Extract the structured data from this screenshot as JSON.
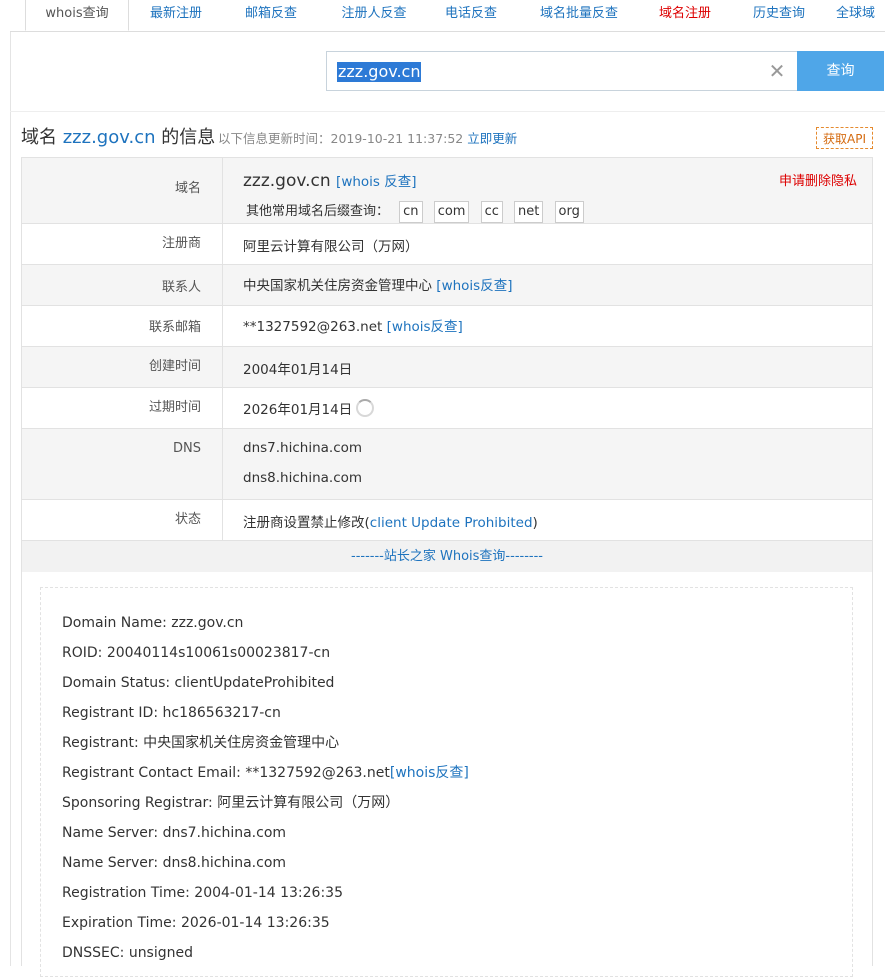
{
  "tabs": [
    {
      "label": "whois查询",
      "active": true,
      "color": ""
    },
    {
      "label": "最新注册",
      "active": false,
      "color": ""
    },
    {
      "label": "邮箱反查",
      "active": false,
      "color": ""
    },
    {
      "label": "注册人反查",
      "active": false,
      "color": ""
    },
    {
      "label": "电话反查",
      "active": false,
      "color": ""
    },
    {
      "label": "域名批量反查",
      "active": false,
      "color": ""
    },
    {
      "label": "域名注册",
      "active": false,
      "color": "#dd0000"
    },
    {
      "label": "历史查询",
      "active": false,
      "color": ""
    },
    {
      "label": "全球域",
      "active": false,
      "color": ""
    }
  ],
  "search": {
    "value": "zzz.gov.cn",
    "button": "查询",
    "clear_icon": "close-icon"
  },
  "header": {
    "title_prefix": "域名 ",
    "title_domain": "zzz.gov.cn",
    "title_suffix": " 的信息",
    "updated_label": "以下信息更新时间：2019-10-21 11:37:52",
    "refresh_link": "立即更新",
    "api_button": "获取API"
  },
  "info": {
    "domain_label": "域名",
    "domain_value": "zzz.gov.cn",
    "domain_whois_link": "[whois 反查]",
    "privacy_link": "申请删除隐私",
    "suffix_label": "其他常用域名后缀查询：",
    "suffixes": [
      "cn",
      "com",
      "cc",
      "net",
      "org"
    ],
    "registrar_label": "注册商",
    "registrar_value": "阿里云计算有限公司（万网）",
    "contact_label": "联系人",
    "contact_value": "中央国家机关住房资金管理中心",
    "contact_link": "[whois反查]",
    "email_label": "联系邮箱",
    "email_value": "**1327592@263.net",
    "email_link": "[whois反查]",
    "created_label": "创建时间",
    "created_value": "2004年01月14日",
    "expires_label": "过期时间",
    "expires_value": "2026年01月14日",
    "dns_label": "DNS",
    "dns_values": [
      "dns7.hichina.com",
      "dns8.hichina.com"
    ],
    "status_label": "状态",
    "status_text": "注册商设置禁止修改(",
    "status_link": "client Update Prohibited",
    "status_close": ")",
    "divider": "-------站长之家 Whois查询--------"
  },
  "raw": [
    "Domain Name: zzz.gov.cn",
    "ROID: 20040114s10061s00023817-cn",
    "Domain Status: clientUpdateProhibited",
    "Registrant ID: hc186563217-cn",
    "Registrant: 中央国家机关住房资金管理中心",
    "Registrant Contact Email: **1327592@263.net",
    "Sponsoring Registrar: 阿里云计算有限公司（万网）",
    "Name Server: dns7.hichina.com",
    "Name Server: dns8.hichina.com",
    "Registration Time: 2004-01-14 13:26:35",
    "Expiration Time: 2026-01-14 13:26:35",
    "DNSSEC: unsigned"
  ],
  "raw_email_link": "[whois反查]",
  "colors": {
    "link": "#1e73be",
    "red": "#dd0000",
    "button": "#4fa6e8",
    "row_alt": "#f5f5f5"
  }
}
